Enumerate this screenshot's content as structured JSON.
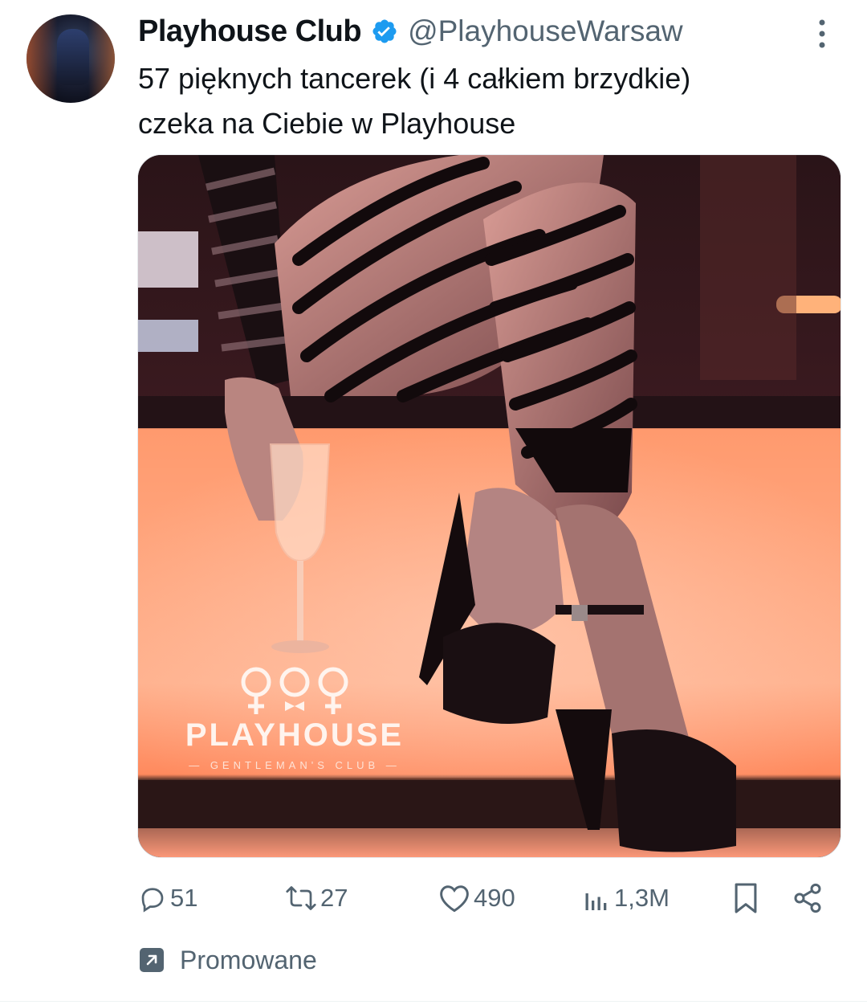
{
  "author": {
    "display_name": "Playhouse Club",
    "handle": "@PlayhouseWarsaw",
    "verified": true,
    "avatar_icon": "avatar-image"
  },
  "tweet": {
    "text_line1": "57 pięknych tancerek (i 4 całkiem brzydkie)",
    "text_line2": "czeka na Ciebie w Playhouse"
  },
  "media": {
    "logo_name": "PLAYHOUSE",
    "logo_subtitle": "— GENTLEMAN'S CLUB —",
    "logo_icon": "female-symbols-bowtie-icon"
  },
  "actions": {
    "replies": "51",
    "retweets": "27",
    "likes": "490",
    "views": "1,3M"
  },
  "promoted": {
    "label": "Promowane",
    "icon": "promoted-arrow-icon"
  },
  "colors": {
    "text_primary": "#0f1419",
    "text_secondary": "#536471",
    "verified_blue": "#1d9bf0"
  }
}
